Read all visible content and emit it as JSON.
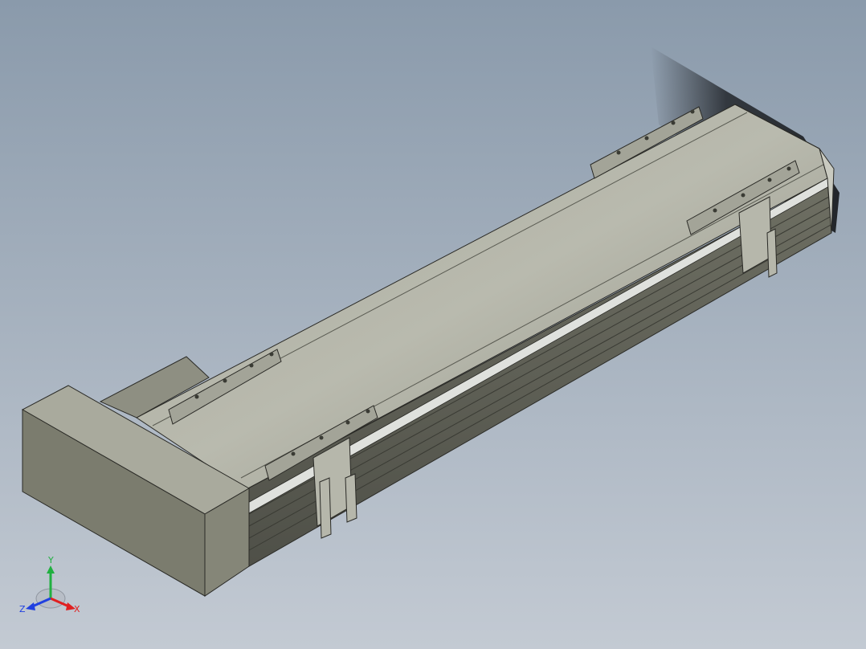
{
  "viewport": {
    "background_top": "#8a9aab",
    "background_bottom": "#c3cad3"
  },
  "model": {
    "body_color": "#9a9b8e",
    "motor_color": "#7d7e6f",
    "rail_color": "#d9dbd8",
    "edge_color": "#2a2a26"
  },
  "triad": {
    "x_label": "X",
    "y_label": "Y",
    "z_label": "Z",
    "x_color": "#e02020",
    "y_color": "#20b040",
    "z_color": "#2040e0"
  }
}
